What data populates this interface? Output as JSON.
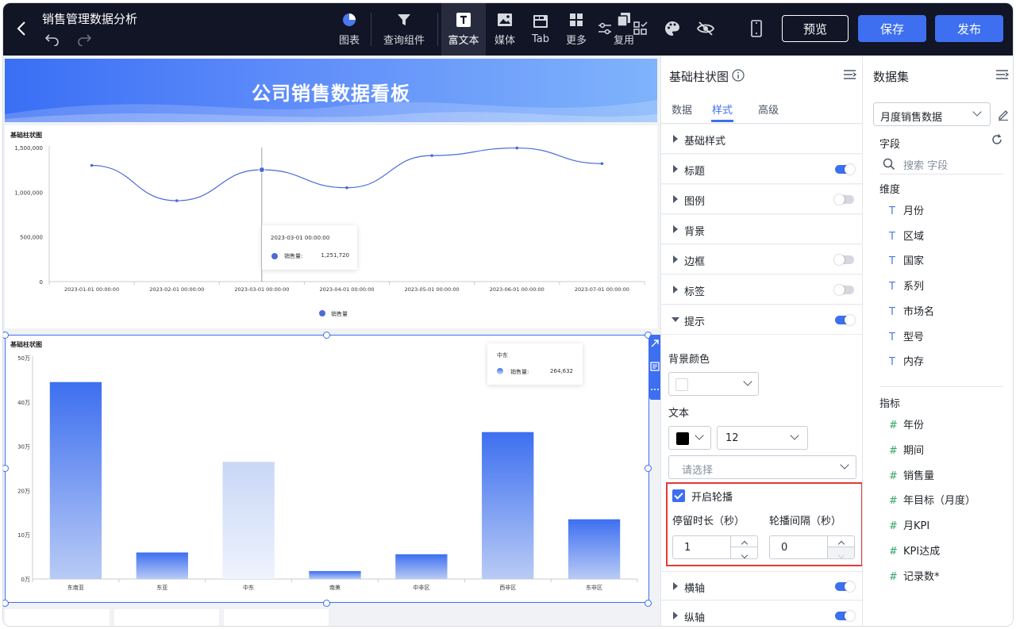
{
  "header": {
    "title": "销售管理数据分析",
    "tools": [
      {
        "label": "图表",
        "icon": "pie-chart-icon"
      },
      {
        "label": "查询组件",
        "icon": "filter-icon"
      },
      {
        "label": "富文本",
        "icon": "text-icon"
      },
      {
        "label": "媒体",
        "icon": "image-icon"
      },
      {
        "label": "Tab",
        "icon": "tab-icon"
      },
      {
        "label": "更多",
        "icon": "grid-icon"
      },
      {
        "label": "复用",
        "icon": "copy-icon"
      }
    ],
    "preview_label": "预览",
    "save_label": "保存",
    "publish_label": "发布"
  },
  "canvas": {
    "banner_title": "公司销售数据看板",
    "line_chart_title": "基础柱状图",
    "line_tooltip_date": "2023-03-01 00:00:00",
    "line_tooltip_label": "销售量:",
    "line_tooltip_value": "1,251,720",
    "line_legend_label": "销售量",
    "bar_chart_title": "基础柱状图",
    "bar_tooltip_title": "中东",
    "bar_tooltip_label": "销售量:",
    "bar_tooltip_value": "264,632"
  },
  "chart_data": [
    {
      "type": "line",
      "title": "基础柱状图",
      "x": [
        "2023-01-01 00:00:00",
        "2023-02-01 00:00:00",
        "2023-03-01 00:00:00",
        "2023-04-01 00:00:00",
        "2023-05-01 00:00:00",
        "2023-06-01 00:00:00",
        "2023-07-01 00:00:00"
      ],
      "series": [
        {
          "name": "销售量",
          "values": [
            1300000,
            905000,
            1251720,
            1050000,
            1410000,
            1495000,
            1320000
          ]
        }
      ],
      "yticks": [
        "1,500,000",
        "1,000,000",
        "500,000",
        "0"
      ],
      "ylim": [
        0,
        1500000
      ],
      "color": "#4a6bd8",
      "legend": "bottom"
    },
    {
      "type": "bar",
      "title": "基础柱状图",
      "categories": [
        "东南亚",
        "东亚",
        "中东",
        "南美",
        "中非区",
        "西非区",
        "东非区"
      ],
      "values": [
        445000,
        60000,
        264632,
        18000,
        56000,
        332000,
        135000
      ],
      "yticks": [
        "50万",
        "40万",
        "30万",
        "20万",
        "10万",
        "0万"
      ],
      "ylim": [
        0,
        500000
      ],
      "color": "#3d6ff0",
      "highlight_color": "#c9d7f6"
    }
  ],
  "panel": {
    "title": "基础柱状图",
    "tabs": [
      "数据",
      "样式",
      "高级"
    ],
    "active_tab": "样式",
    "sections": [
      {
        "label": "基础样式"
      },
      {
        "label": "标题",
        "toggle": "on"
      },
      {
        "label": "图例",
        "toggle": "off"
      },
      {
        "label": "背景"
      },
      {
        "label": "边框",
        "toggle": "off"
      },
      {
        "label": "标签",
        "toggle": "off"
      },
      {
        "label": "提示",
        "toggle": "on"
      }
    ],
    "tooltip": {
      "bg_color_label": "背景颜色",
      "text_label": "文本",
      "font_size": "12",
      "select_placeholder": "请选择",
      "carousel_label": "开启轮播",
      "dwell_label": "停留时长（秒）",
      "dwell_value": "1",
      "interval_label": "轮播间隔（秒）",
      "interval_value": "0"
    },
    "sections_after": [
      {
        "label": "横轴",
        "toggle": "on"
      },
      {
        "label": "纵轴",
        "toggle": "on"
      }
    ]
  },
  "dataset": {
    "title": "数据集",
    "selected": "月度销售数据",
    "fields_label": "字段",
    "search_placeholder": "搜索 字段",
    "dimension_label": "维度",
    "dimensions": [
      "月份",
      "区域",
      "国家",
      "系列",
      "市场名",
      "型号",
      "内存"
    ],
    "metric_label": "指标",
    "metrics": [
      "年份",
      "期间",
      "销售量",
      "年目标（月度）",
      "月KPI",
      "KPI达成",
      "记录数*"
    ]
  }
}
